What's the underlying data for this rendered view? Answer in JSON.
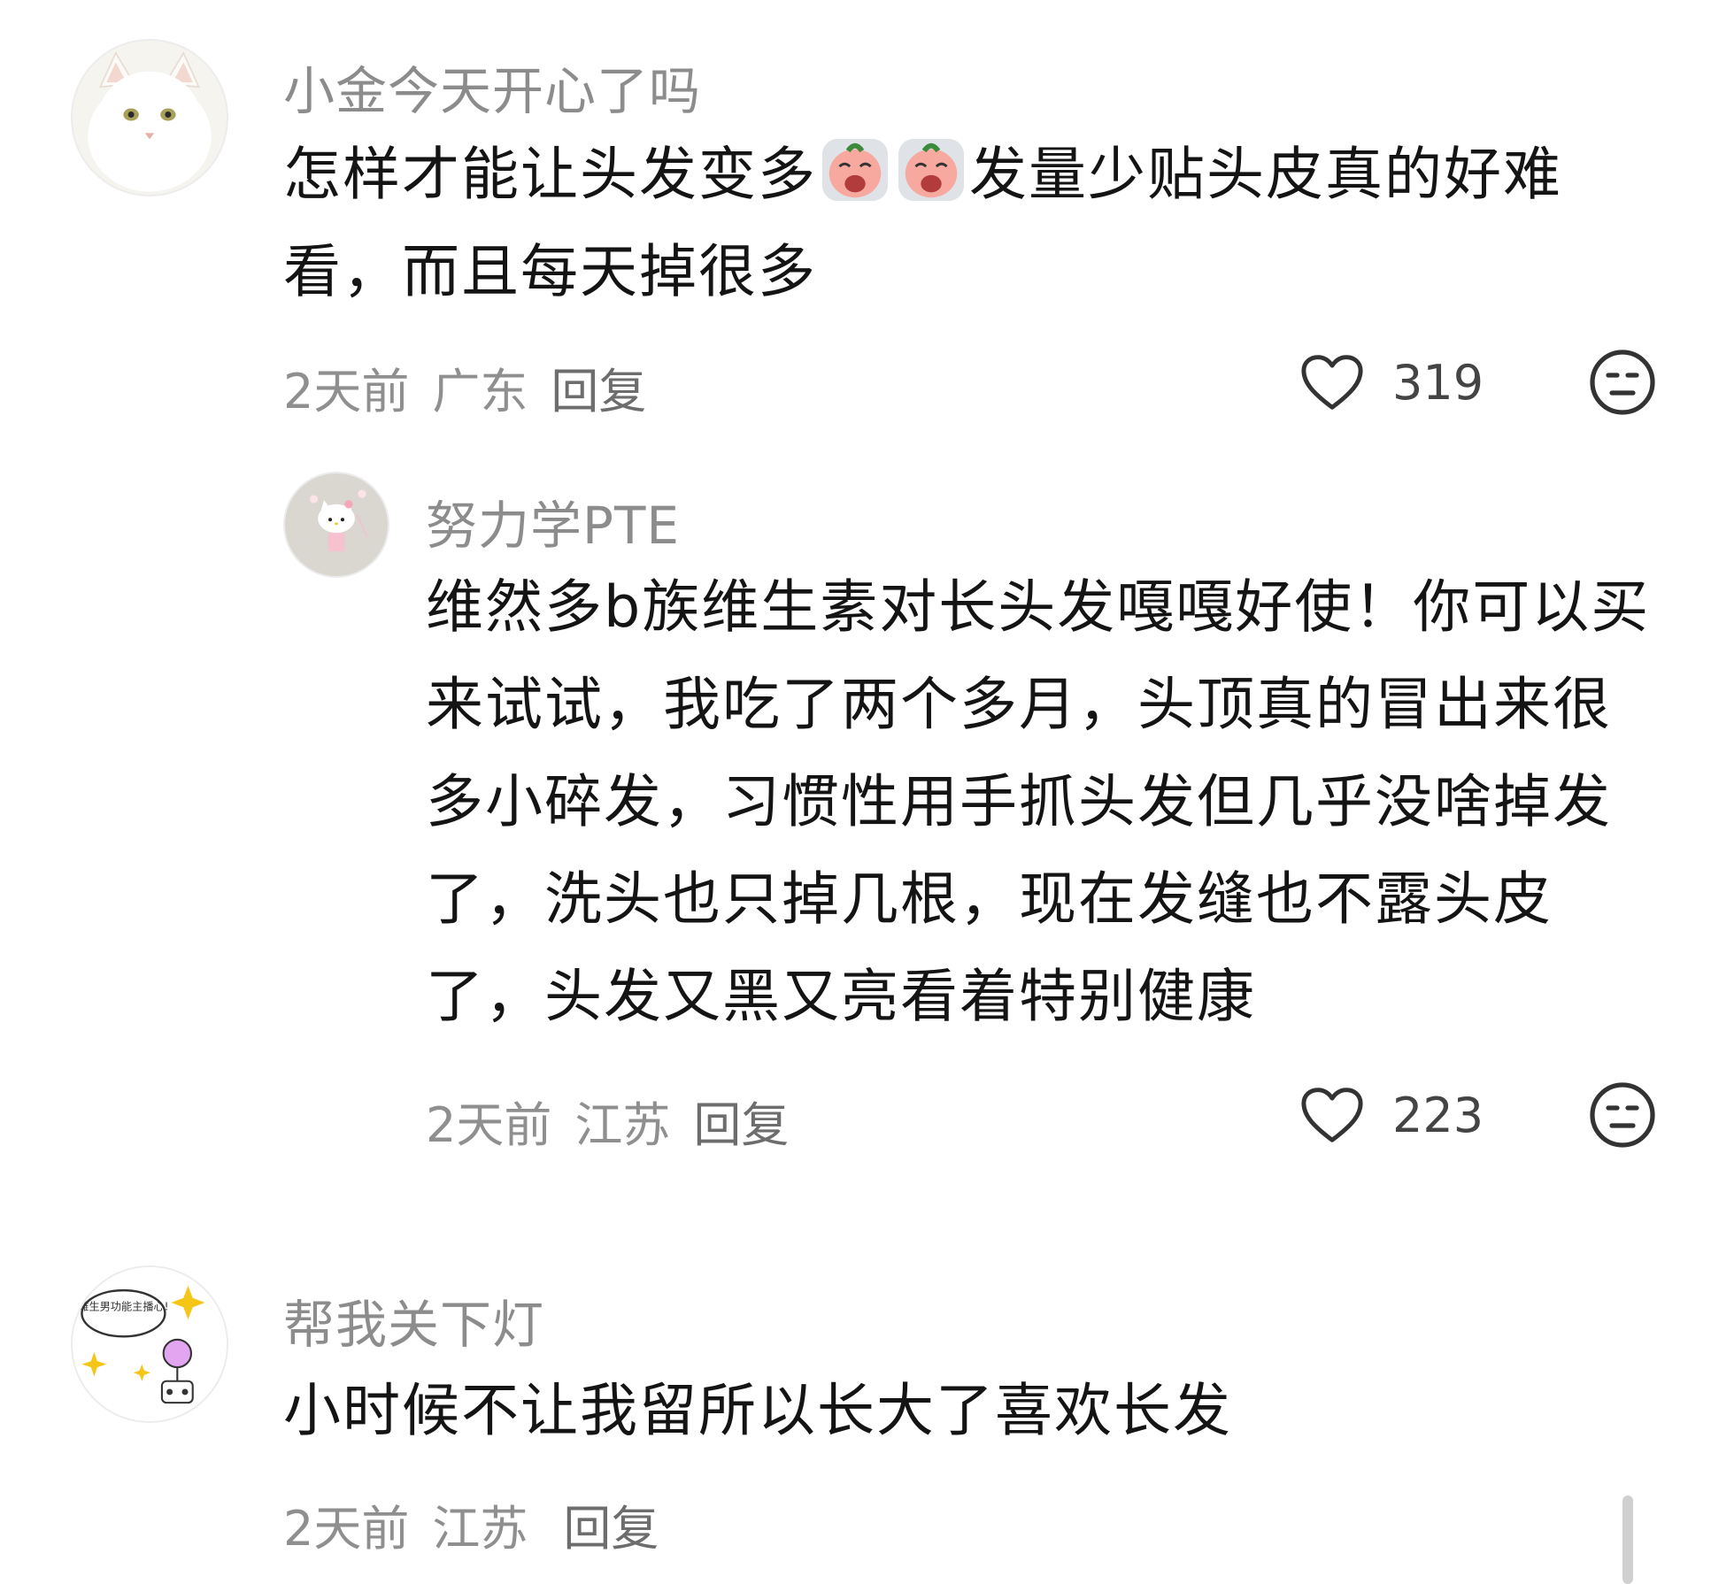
{
  "comments": [
    {
      "username": "小金今天开心了吗",
      "text_before_emoji": "怎样才能让头发变多",
      "emojis": [
        "crying-emoji",
        "crying-emoji"
      ],
      "text_after_emoji": "发量少贴头皮真的好难看，而且每天掉很多",
      "time": "2天前",
      "location": "广东",
      "reply_label": "回复",
      "likes": "319",
      "avatar_icon": "white-cat-avatar"
    },
    {
      "username": "努力学PTE",
      "text": "维然多b族维生素对长头发嘎嘎好使！你可以买来试试，我吃了两个多月，头顶真的冒出来很多小碎发，习惯性用手抓头发但几乎没啥掉发了，洗头也只掉几根，现在发缝也不露头皮了，头发又黑又亮看着特别健康",
      "time": "2天前",
      "location": "江苏",
      "reply_label": "回复",
      "likes": "223",
      "avatar_icon": "hello-kitty-avatar"
    },
    {
      "username": "帮我关下灯",
      "text": "小时候不让我留所以长大了喜欢长发",
      "time": "2天前",
      "location": "江苏",
      "reply_label": "回复",
      "avatar_icon": "doodle-avatar",
      "avatar_doodle_text": "雌生男功能主播心!"
    }
  ],
  "colors": {
    "username": "#8c8c8c",
    "text": "#141414",
    "meta": "#8f8f8f",
    "emoji_face": "#f7a9a0",
    "sparkle": "#f5c518"
  }
}
